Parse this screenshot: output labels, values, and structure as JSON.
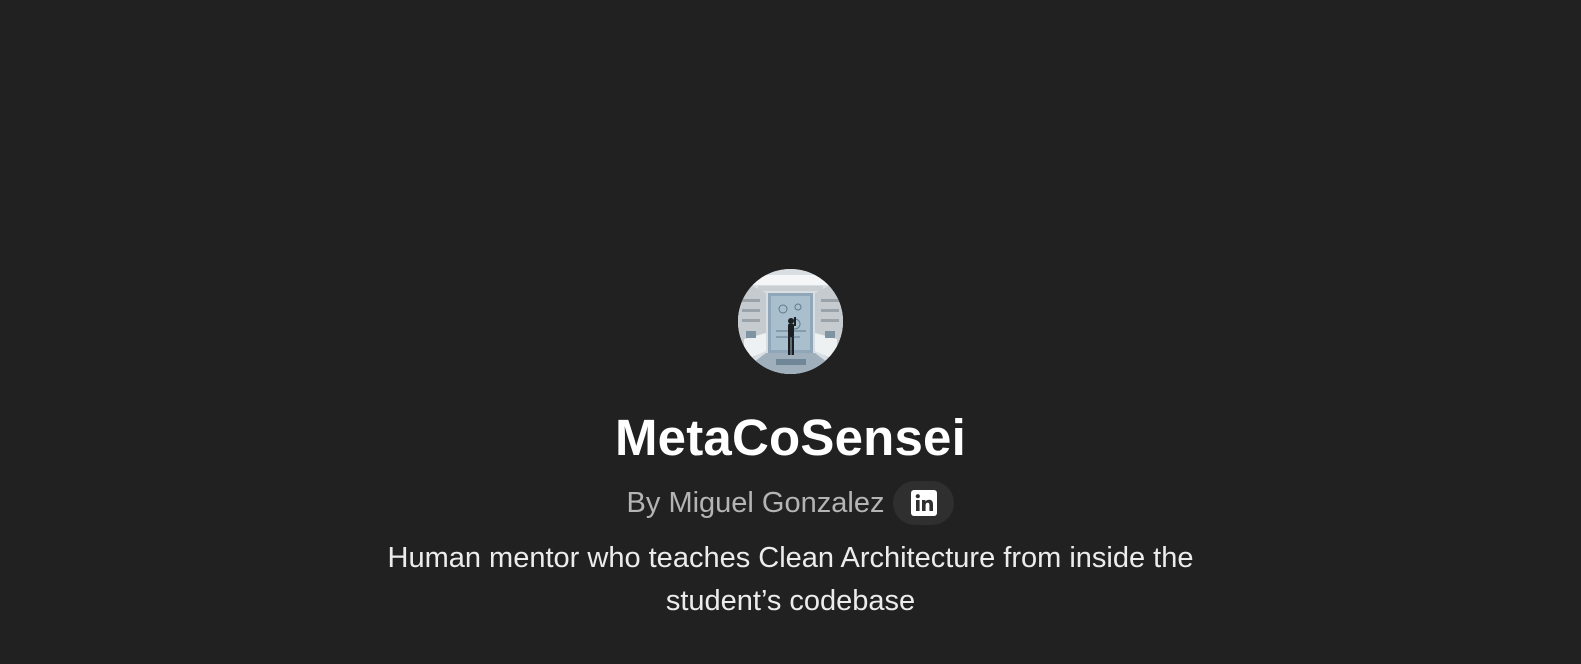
{
  "gpt": {
    "name": "MetaCoSensei",
    "author": "By Miguel Gonzalez",
    "description": "Human mentor who teaches Clean Architecture from inside the student’s codebase",
    "avatar_icon": "avatar-image",
    "social_icon": "linkedin-icon"
  },
  "colors": {
    "background": "#212121",
    "title": "#ffffff",
    "byline": "#b4b4b4",
    "social_button_bg": "#2f2f2f"
  }
}
